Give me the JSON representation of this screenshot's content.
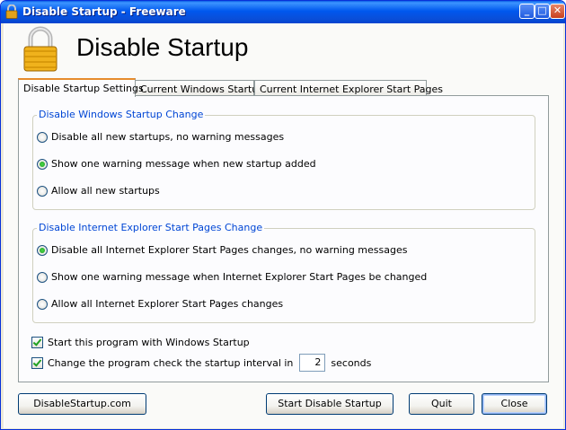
{
  "window": {
    "title": "Disable Startup - Freeware",
    "controls": {
      "minimize": "_",
      "maximize": "□",
      "close": "✕"
    }
  },
  "header": {
    "title": "Disable Startup",
    "icon": "padlock-icon"
  },
  "tabs": [
    {
      "label": "Disable Startup Settings",
      "active": true
    },
    {
      "label": "Current Windows Startup",
      "active": false
    },
    {
      "label": "Current Internet Explorer Start Pages",
      "active": false
    }
  ],
  "windows_group": {
    "label": "Disable Windows Startup Change",
    "options": [
      {
        "label": "Disable all new startups, no warning messages",
        "selected": false
      },
      {
        "label": "Show one warning message when new startup added",
        "selected": true
      },
      {
        "label": "Allow all new startups",
        "selected": false
      }
    ]
  },
  "ie_group": {
    "label": "Disable Internet Explorer Start Pages Change",
    "options": [
      {
        "label": "Disable all Internet Explorer Start Pages changes, no warning messages",
        "selected": true
      },
      {
        "label": "Show one warning message when Internet Explorer Start Pages be changed",
        "selected": false
      },
      {
        "label": "Allow all Internet Explorer Start Pages changes",
        "selected": false
      }
    ]
  },
  "checkboxes": {
    "start_with_windows": {
      "label": "Start this program with Windows Startup",
      "checked": true
    },
    "check_interval": {
      "label": "Change the program check the startup interval in",
      "checked": true,
      "value": "2",
      "suffix": "seconds"
    }
  },
  "buttons": {
    "website": "DisableStartup.com",
    "start": "Start Disable Startup",
    "quit": "Quit",
    "close": "Close"
  },
  "colors": {
    "titlebar": "#0058ee",
    "group_label": "#0046d5",
    "active_tab_accent": "#e68b2c"
  }
}
